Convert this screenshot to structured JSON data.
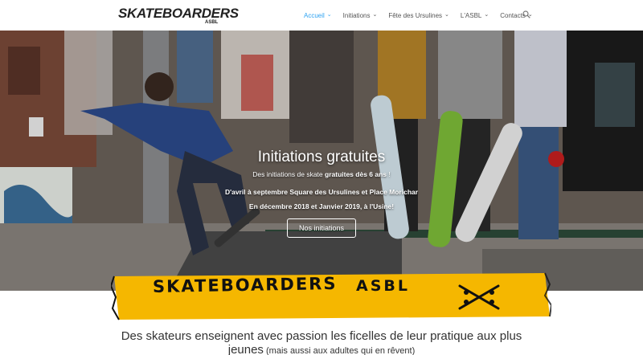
{
  "header": {
    "logo": {
      "text": "SKATEBOARDERS",
      "sub": "ASBL"
    },
    "nav": [
      {
        "label": "Accueil",
        "active": true
      },
      {
        "label": "Initiations",
        "active": false
      },
      {
        "label": "Fête des Ursulines",
        "active": false
      },
      {
        "label": "L'ASBL",
        "active": false
      },
      {
        "label": "Contacts",
        "active": false
      }
    ],
    "search_icon": "search-icon",
    "accent_color": "#2ea3f2"
  },
  "hero": {
    "title": "Initiations gratuites",
    "line1_pre": "Des initiations de skate ",
    "line1_bold": "gratuites dès 6 ans",
    "line1_post": " !",
    "line2": "D'avril à septembre Square des Ursulines et Place Morichar",
    "line3": "En décembre 2018 et Janvier 2019, à l'Usine!",
    "button_label": "Nos initiations"
  },
  "banner": {
    "text": "SKATEBOARDERS",
    "asbl": "ASBL",
    "icon": "crossed-skateboards-icon",
    "color": "#f5b700"
  },
  "intro": {
    "line1": "Des skateurs enseignent avec passion les ficelles de leur pratique aux plus",
    "line2_main": "jeunes",
    "line2_small": " (mais aussi aux adultes qui en rêvent)"
  }
}
